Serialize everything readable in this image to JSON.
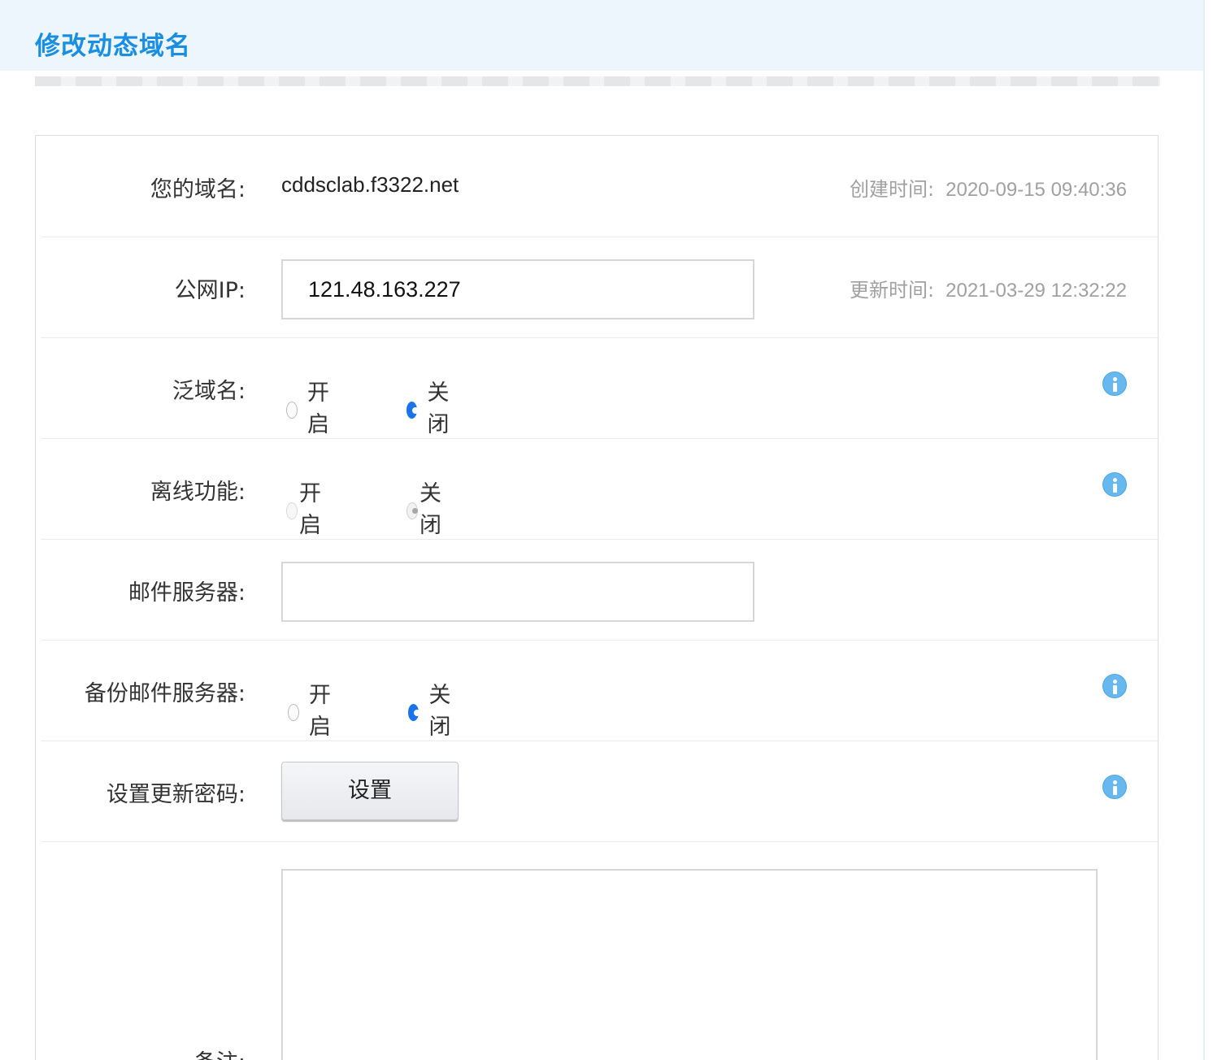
{
  "header": {
    "title": "修改动态域名"
  },
  "form": {
    "domain": {
      "label": "您的域名:",
      "value": "cddsclab.f3322.net",
      "created_label": "创建时间:",
      "created_value": "2020-09-15 09:40:36"
    },
    "public_ip": {
      "label": "公网IP:",
      "value": "121.48.163.227",
      "updated_label": "更新时间:",
      "updated_value": "2021-03-29 12:32:22"
    },
    "wildcard": {
      "label": "泛域名:",
      "on_label": "开启",
      "off_label": "关闭",
      "selected": "off"
    },
    "offline": {
      "label": "离线功能:",
      "on_label": "开启",
      "off_label": "关闭",
      "selected": "off",
      "disabled": true
    },
    "mail_server": {
      "label": "邮件服务器:",
      "value": ""
    },
    "backup_mail": {
      "label": "备份邮件服务器:",
      "on_label": "开启",
      "off_label": "关闭",
      "selected": "off"
    },
    "update_password": {
      "label": "设置更新密码:",
      "button_label": "设置"
    },
    "remark": {
      "label": "备注:",
      "value": ""
    }
  },
  "colors": {
    "accent": "#1a8ee0",
    "radio_checked": "#1a73e8",
    "info_icon": "#66b8ee",
    "header_bg": "#eef6fd"
  },
  "icons": {
    "info": "info-icon",
    "resize": "resize-grip-icon"
  }
}
